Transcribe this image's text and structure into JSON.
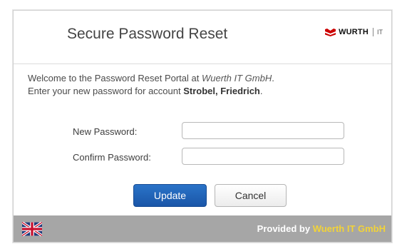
{
  "header": {
    "title": "Secure Password Reset",
    "logo": {
      "brand": "WURTH",
      "sub": "IT",
      "icon": "wuerth-logo-icon"
    }
  },
  "intro": {
    "line1_prefix": "Welcome to the Password Reset Portal at ",
    "line1_company": "Wuerth IT GmbH",
    "line1_suffix": ".",
    "line2_prefix": "Enter your new password for account ",
    "line2_account": "Strobel, Friedrich",
    "line2_suffix": "."
  },
  "form": {
    "new_password_label": "New Password:",
    "new_password_value": "",
    "confirm_password_label": "Confirm Password:",
    "confirm_password_value": ""
  },
  "buttons": {
    "update": "Update",
    "cancel": "Cancel"
  },
  "footer": {
    "provided_by": "Provided by ",
    "company": "Wuerth IT GmbH",
    "language_icon": "uk-flag-icon"
  },
  "colors": {
    "primary_button": "#1f62b6",
    "footer_bg": "#a6a6a6",
    "footer_company": "#f2d338",
    "logo_red": "#cc0000"
  }
}
